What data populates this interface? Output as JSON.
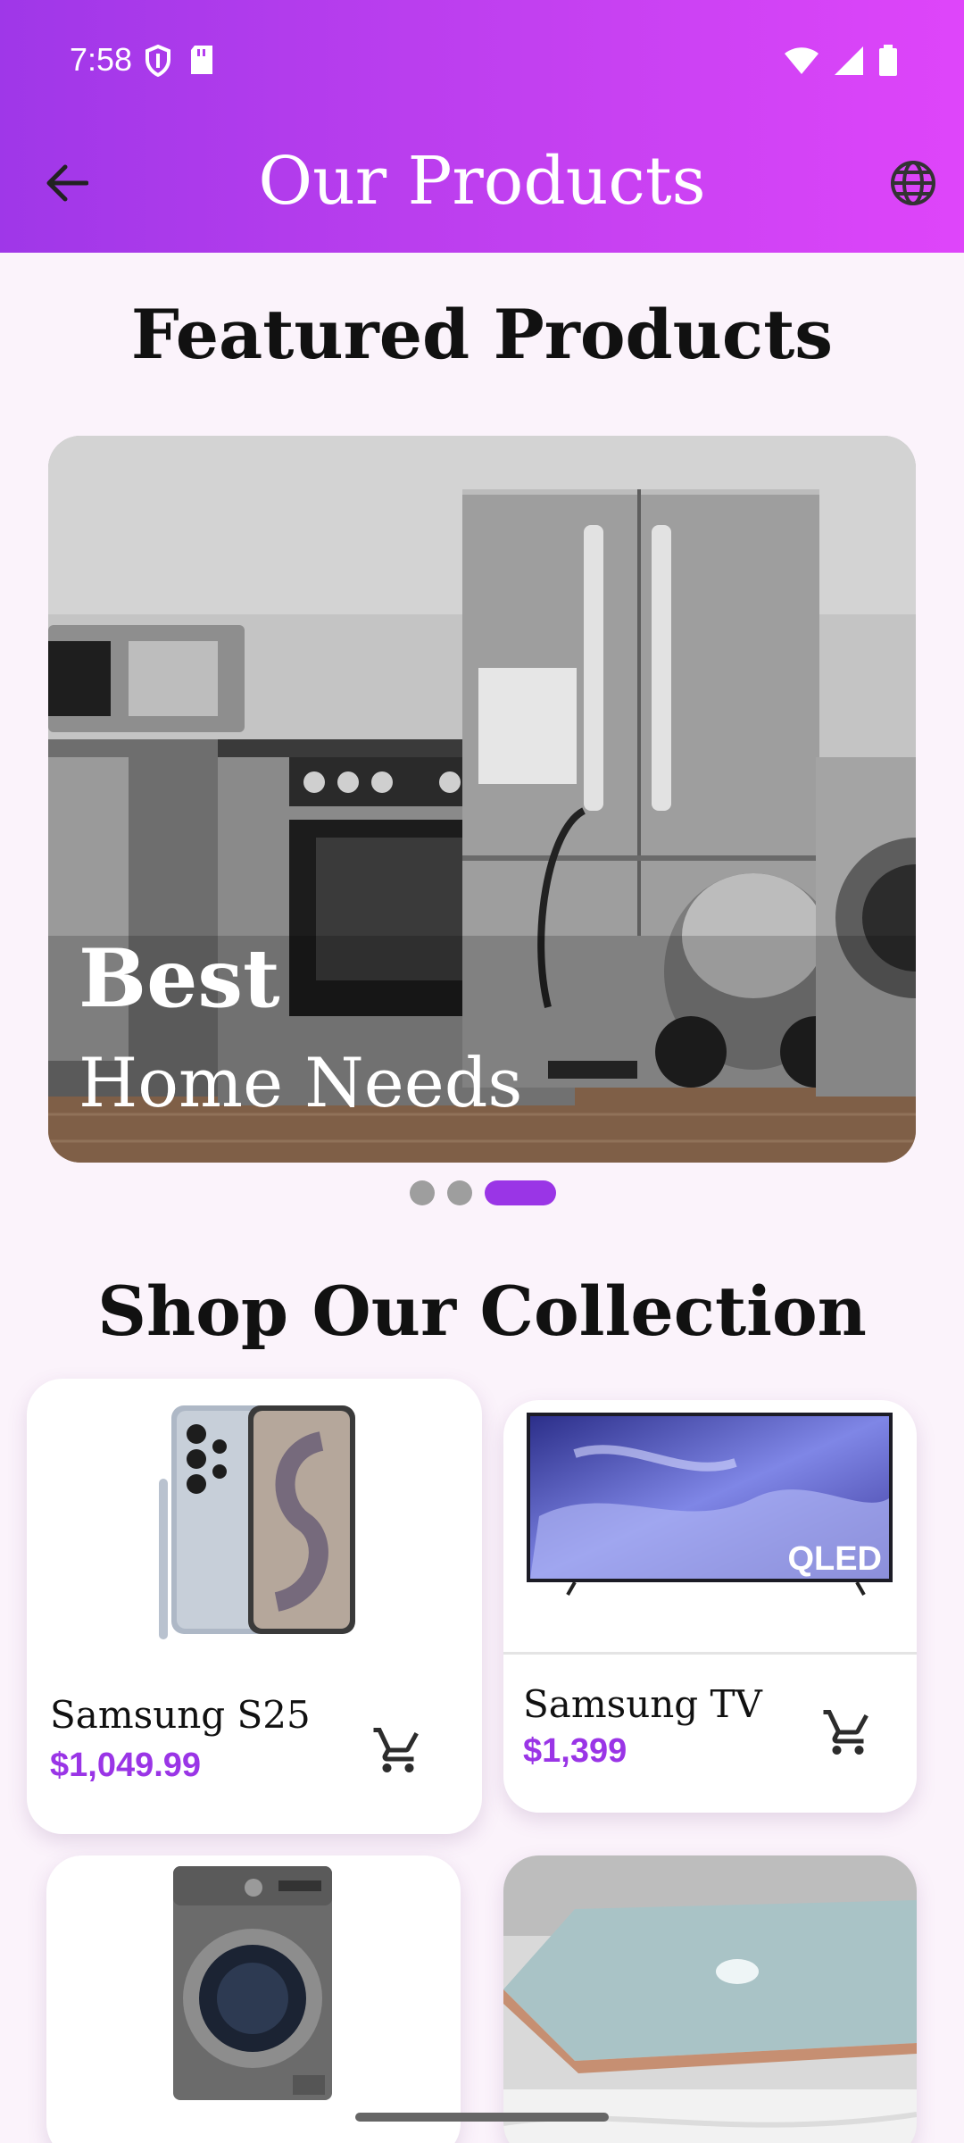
{
  "status_bar": {
    "time": "7:58"
  },
  "header": {
    "title": "Our Products"
  },
  "featured": {
    "title": "Featured Products",
    "banner": {
      "line1": "Best",
      "line2": "Home Needs"
    },
    "active_slide": 3,
    "slide_count": 3
  },
  "collection": {
    "title": "Shop Our Collection",
    "products": [
      {
        "name": "Samsung S25",
        "price": "$1,049.99"
      },
      {
        "name": "Samsung TV",
        "price": "$1,399",
        "badge": "QLED"
      },
      {
        "name": "",
        "price": ""
      },
      {
        "name": "",
        "price": ""
      }
    ]
  },
  "colors": {
    "accent": "#9a35e6",
    "header_start": "#9f37e8",
    "header_end": "#df45fa",
    "background": "#fbf3fb"
  },
  "icons": [
    "back-arrow-icon",
    "globe-icon",
    "cart-icon",
    "shield-icon",
    "sd-card-icon",
    "wifi-icon",
    "signal-icon",
    "battery-icon"
  ]
}
